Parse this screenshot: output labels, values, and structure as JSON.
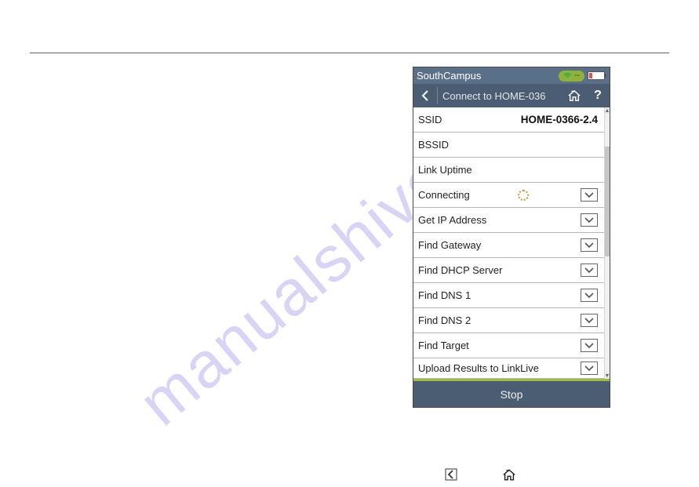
{
  "watermark": "manualshive.com",
  "status": {
    "profile": "SouthCampus",
    "wifi_text": "--"
  },
  "titlebar": {
    "title": "Connect to HOME-036"
  },
  "rows": {
    "ssid_label": "SSID",
    "ssid_value": "HOME-0366-2.4",
    "bssid_label": "BSSID",
    "link_uptime_label": "Link Uptime",
    "connecting_label": "Connecting",
    "get_ip_label": "Get IP Address",
    "find_gateway_label": "Find Gateway",
    "find_dhcp_label": "Find DHCP Server",
    "find_dns1_label": "Find DNS 1",
    "find_dns2_label": "Find DNS 2",
    "find_target_label": "Find Target",
    "upload_label": "Upload Results to LinkLive"
  },
  "footer": {
    "stop": "Stop"
  }
}
